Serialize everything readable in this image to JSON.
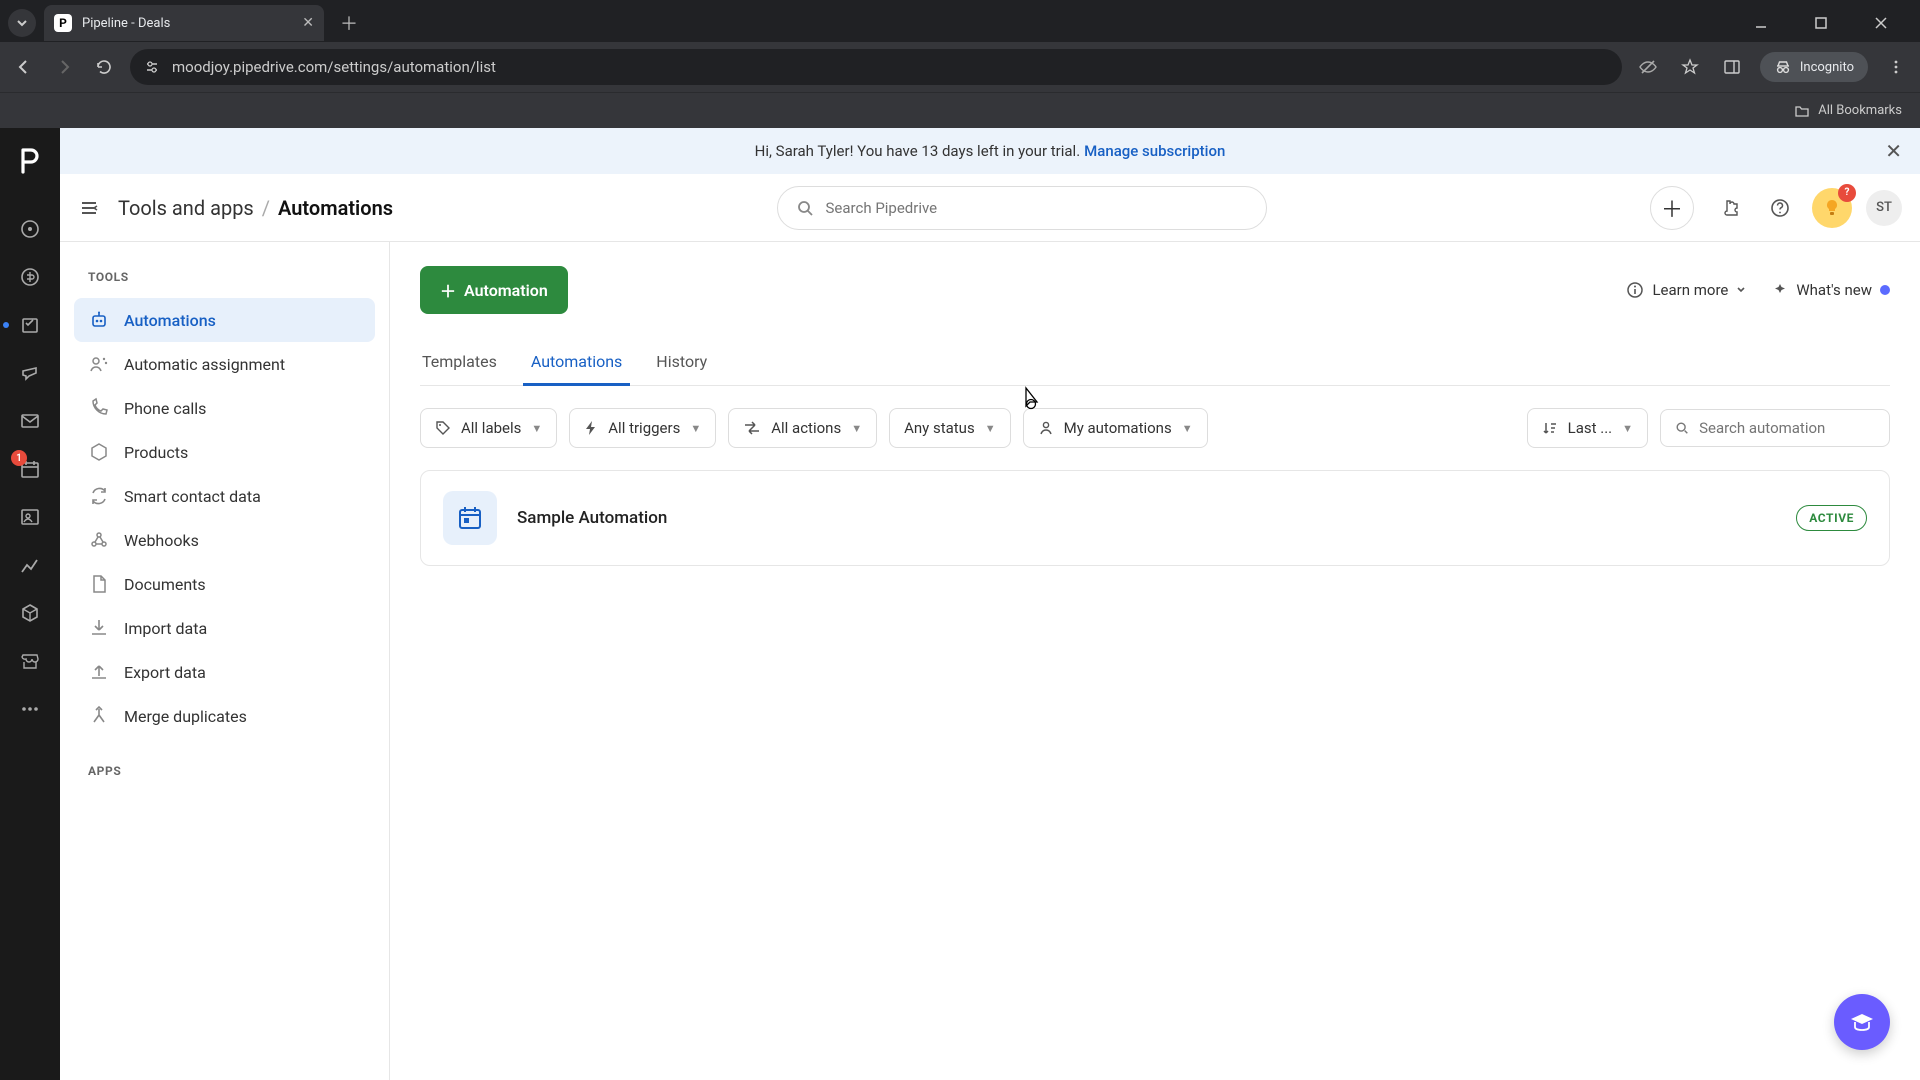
{
  "browser": {
    "tab_title": "Pipeline - Deals",
    "url": "moodjoy.pipedrive.com/settings/automation/list",
    "incognito_label": "Incognito",
    "bookmarks_label": "All Bookmarks"
  },
  "banner": {
    "text": "Hi, Sarah Tyler! You have 13 days left in your trial.",
    "link": "Manage subscription"
  },
  "topbar": {
    "breadcrumb1": "Tools and apps",
    "breadcrumb2": "Automations",
    "search_placeholder": "Search Pipedrive",
    "learn_more": "Learn more",
    "whats_new": "What's new",
    "avatar_initials": "ST",
    "assist_badge": "?"
  },
  "rail_badge": "1",
  "sidebar": {
    "section_tools": "TOOLS",
    "section_apps": "APPS",
    "items": [
      {
        "label": "Automations"
      },
      {
        "label": "Automatic assignment"
      },
      {
        "label": "Phone calls"
      },
      {
        "label": "Products"
      },
      {
        "label": "Smart contact data"
      },
      {
        "label": "Webhooks"
      },
      {
        "label": "Documents"
      },
      {
        "label": "Import data"
      },
      {
        "label": "Export data"
      },
      {
        "label": "Merge duplicates"
      }
    ]
  },
  "content": {
    "primary_btn": "Automation",
    "tabs": [
      {
        "label": "Templates"
      },
      {
        "label": "Automations"
      },
      {
        "label": "History"
      }
    ],
    "filters": {
      "labels": "All labels",
      "triggers": "All triggers",
      "actions": "All actions",
      "status": "Any status",
      "owner": "My automations",
      "sort": "Last ...",
      "search_placeholder": "Search automation"
    },
    "automation": {
      "name": "Sample Automation",
      "status": "ACTIVE"
    }
  }
}
